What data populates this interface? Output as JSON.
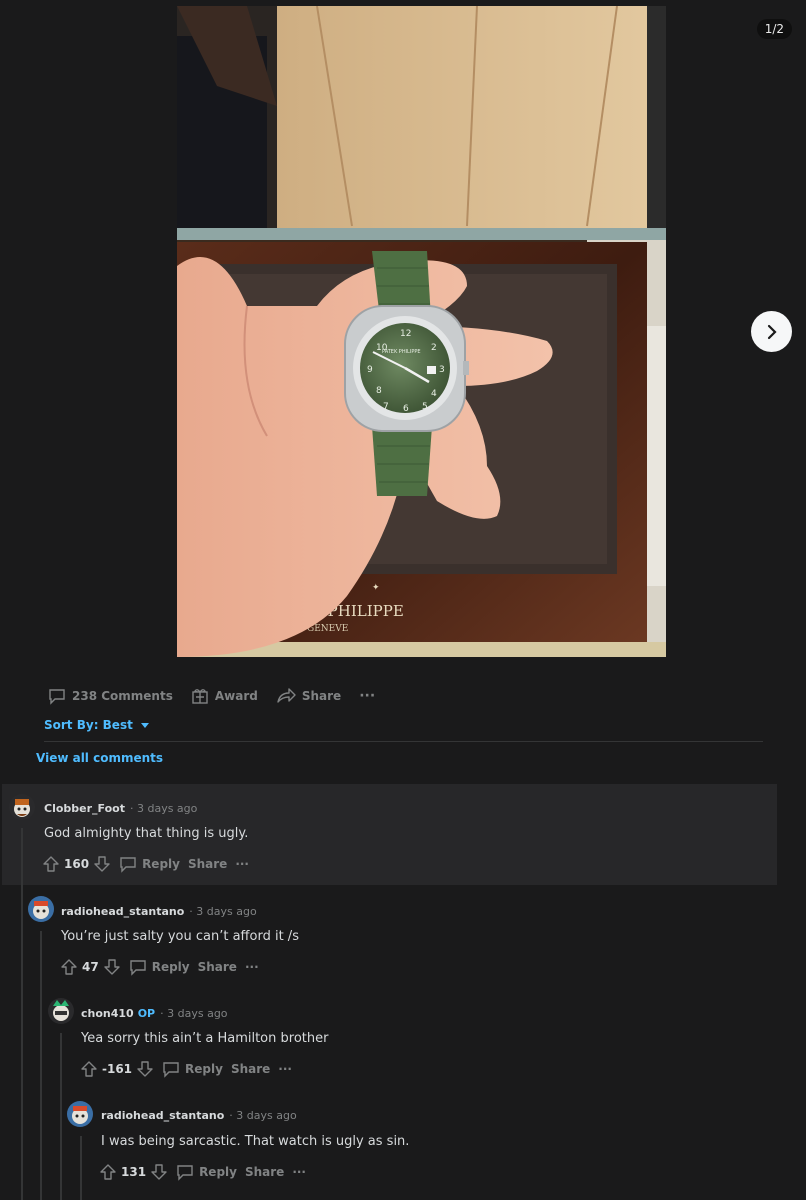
{
  "media": {
    "counter": "1/2",
    "brand_text": "PATEK PHILIPPE",
    "brand_sub": "GENEVE",
    "dial_logo": "PATEK PHILIPPE"
  },
  "post_actions": {
    "comments": "238 Comments",
    "award": "Award",
    "share": "Share",
    "more": "···"
  },
  "sort": {
    "label": "Sort By: Best"
  },
  "view_all": "View all comments",
  "comments": [
    {
      "user": "Clobber_Foot",
      "op": "",
      "time": "· 3 days ago",
      "body": "God almighty that thing is ugly.",
      "score": "160",
      "reply": "Reply",
      "share": "Share",
      "more": "···"
    },
    {
      "user": "radiohead_stantano",
      "op": "",
      "time": "· 3 days ago",
      "body": "You’re just salty you can’t afford it /s",
      "score": "47",
      "reply": "Reply",
      "share": "Share",
      "more": "···"
    },
    {
      "user": "chon410",
      "op": "OP",
      "time": "· 3 days ago",
      "body": "Yea sorry this ain’t a Hamilton brother",
      "score": "-161",
      "reply": "Reply",
      "share": "Share",
      "more": "···"
    },
    {
      "user": "radiohead_stantano",
      "op": "",
      "time": "· 3 days ago",
      "body": "I was being sarcastic. That watch is ugly as sin.",
      "score": "131",
      "reply": "Reply",
      "share": "Share",
      "more": "···"
    }
  ],
  "colors": {
    "accent": "#4fbcff",
    "bg": "#1a1a1b",
    "highlight": "#272729",
    "muted": "#818384"
  }
}
